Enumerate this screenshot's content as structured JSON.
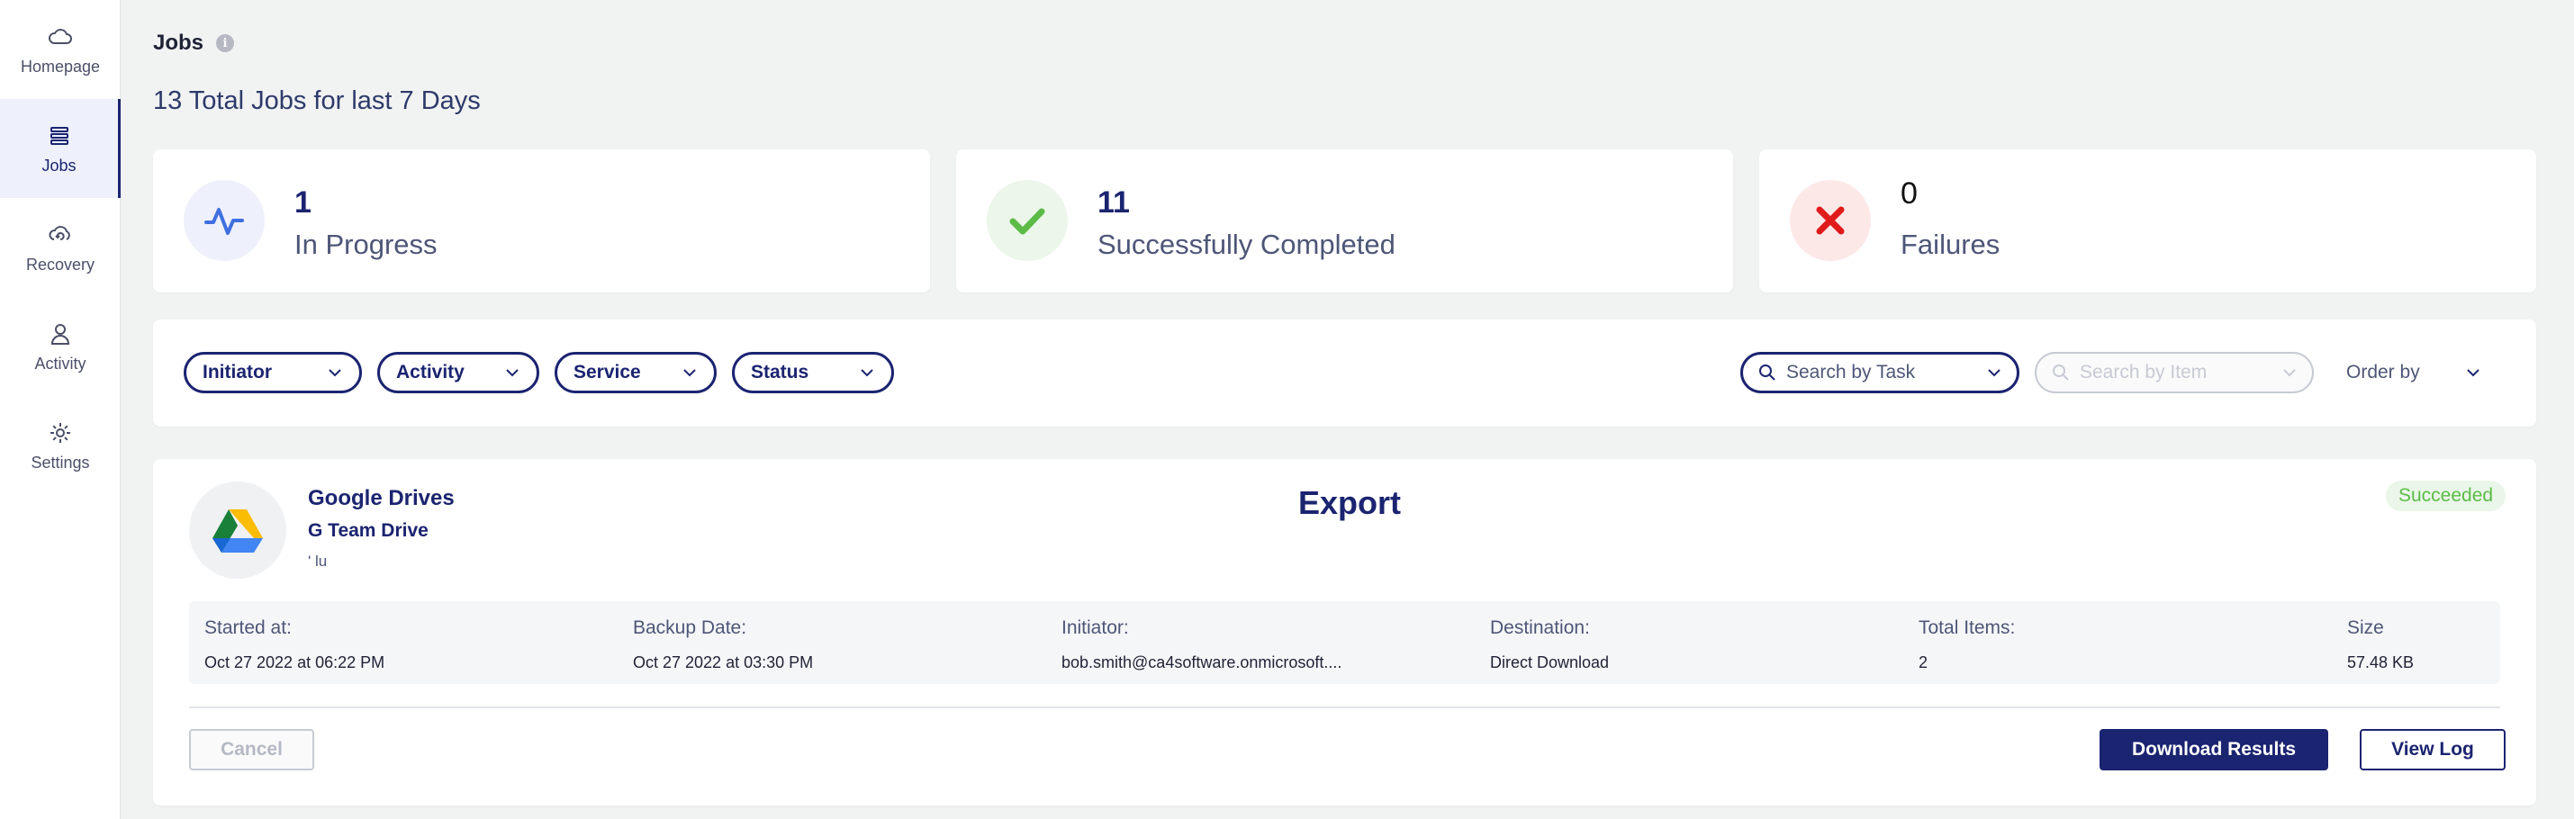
{
  "sidebar": {
    "items": [
      {
        "label": "Homepage",
        "icon": "cloud-icon"
      },
      {
        "label": "Jobs",
        "icon": "jobs-icon",
        "active": true
      },
      {
        "label": "Recovery",
        "icon": "recovery-icon"
      },
      {
        "label": "Activity",
        "icon": "user-icon"
      },
      {
        "label": "Settings",
        "icon": "gear-icon"
      }
    ]
  },
  "header": {
    "title": "Jobs",
    "info_glyph": "i",
    "subtitle": "13 Total Jobs for last 7 Days"
  },
  "stats": [
    {
      "value": "1",
      "label": "In Progress",
      "icon": "activity-pulse-icon",
      "color": "#3f6fe0",
      "bg": "#eef1fb"
    },
    {
      "value": "11",
      "label": "Successfully Completed",
      "icon": "check-icon",
      "color": "#5dbb47",
      "bg": "#ecf6ea"
    },
    {
      "value": "0",
      "label": "Failures",
      "icon": "x-icon",
      "color": "#e01b1b",
      "bg": "#fde8e8"
    }
  ],
  "filters": {
    "pills": [
      "Initiator",
      "Activity",
      "Service",
      "Status"
    ],
    "search_task_placeholder": "Search by Task",
    "search_item_placeholder": "Search by Item",
    "order_by_label": "Order by"
  },
  "job": {
    "service": "Google Drives",
    "drive": "G Team Drive",
    "note": "' lu",
    "type": "Export",
    "status": "Succeeded",
    "details": [
      {
        "label": "Started at:",
        "value": "Oct 27 2022 at 06:22 PM"
      },
      {
        "label": "Backup Date:",
        "value": "Oct 27 2022 at 03:30 PM"
      },
      {
        "label": "Initiator:",
        "value": "bob.smith@ca4software.onmicrosoft...."
      },
      {
        "label": "Destination:",
        "value": "Direct Download"
      },
      {
        "label": "Total Items:",
        "value": "2"
      },
      {
        "label": "Size",
        "value": "57.48 KB"
      }
    ],
    "cancel_label": "Cancel",
    "download_label": "Download Results",
    "log_label": "View Log"
  },
  "colors": {
    "accent": "#1b2470",
    "success": "#5dbb47",
    "failure": "#e01b1b",
    "progress": "#3f6fe0"
  }
}
